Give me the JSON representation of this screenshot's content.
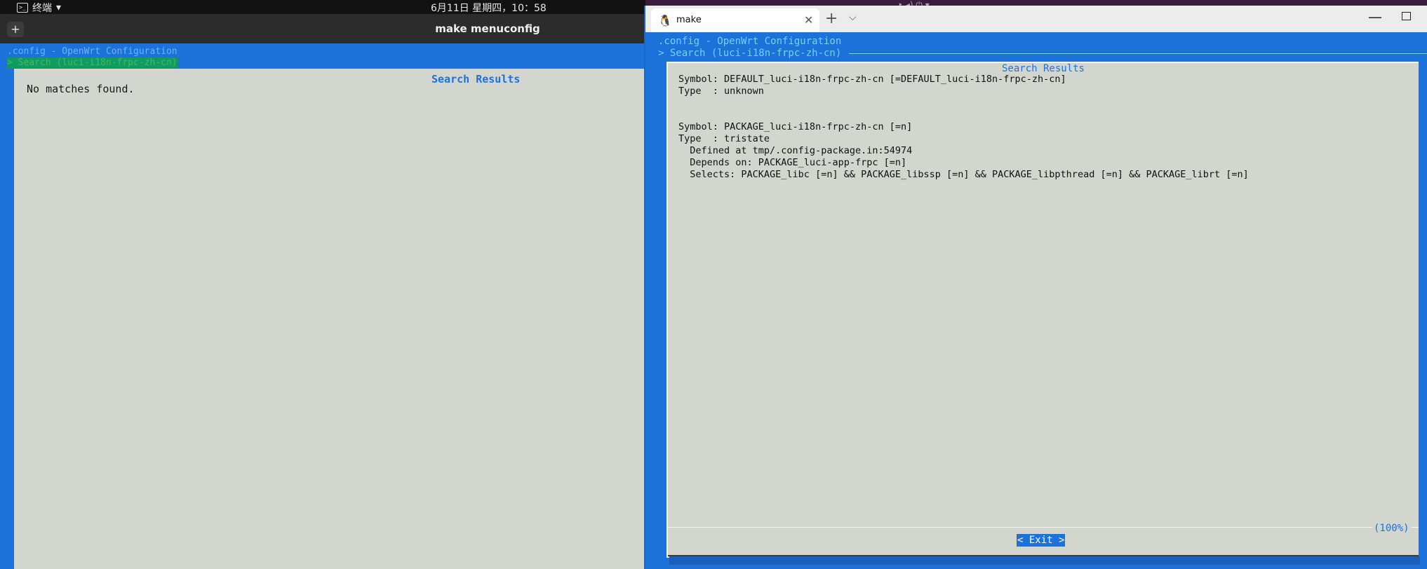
{
  "topbar": {
    "app_name": "终端",
    "clock": "6月11日 星期四，10：58",
    "right_fragment": "‣ ◂) ⏻ ▾"
  },
  "left_terminal": {
    "title": "make menuconfig",
    "newtab_icon": "+",
    "line1": ".config - OpenWrt Configuration",
    "line2": "> Search (luci-i18n-frpc-zh-cn)",
    "dialog_title": "Search Results",
    "message": "No matches found."
  },
  "right_window": {
    "tab_label": "make",
    "tab_icon": "linux-penguin-icon",
    "header_line1": ".config - OpenWrt Configuration",
    "header_line2": "> Search (luci-i18n-frpc-zh-cn)",
    "dialog_title": "Search Results",
    "content": "Symbol: DEFAULT_luci-i18n-frpc-zh-cn [=DEFAULT_luci-i18n-frpc-zh-cn]\nType  : unknown\n\n\nSymbol: PACKAGE_luci-i18n-frpc-zh-cn [=n]\nType  : tristate\n  Defined at tmp/.config-package.in:54974\n  Depends on: PACKAGE_luci-app-frpc [=n]\n  Selects: PACKAGE_libc [=n] && PACKAGE_libssp [=n] && PACKAGE_libpthread [=n] && PACKAGE_librt [=n]",
    "percent": "(100%)",
    "exit_label": "< Exit >"
  },
  "colors": {
    "terminal_blue": "#1d72d9",
    "dialog_gray": "#d2d6ce",
    "header_cyan": "#7bd0ff"
  }
}
